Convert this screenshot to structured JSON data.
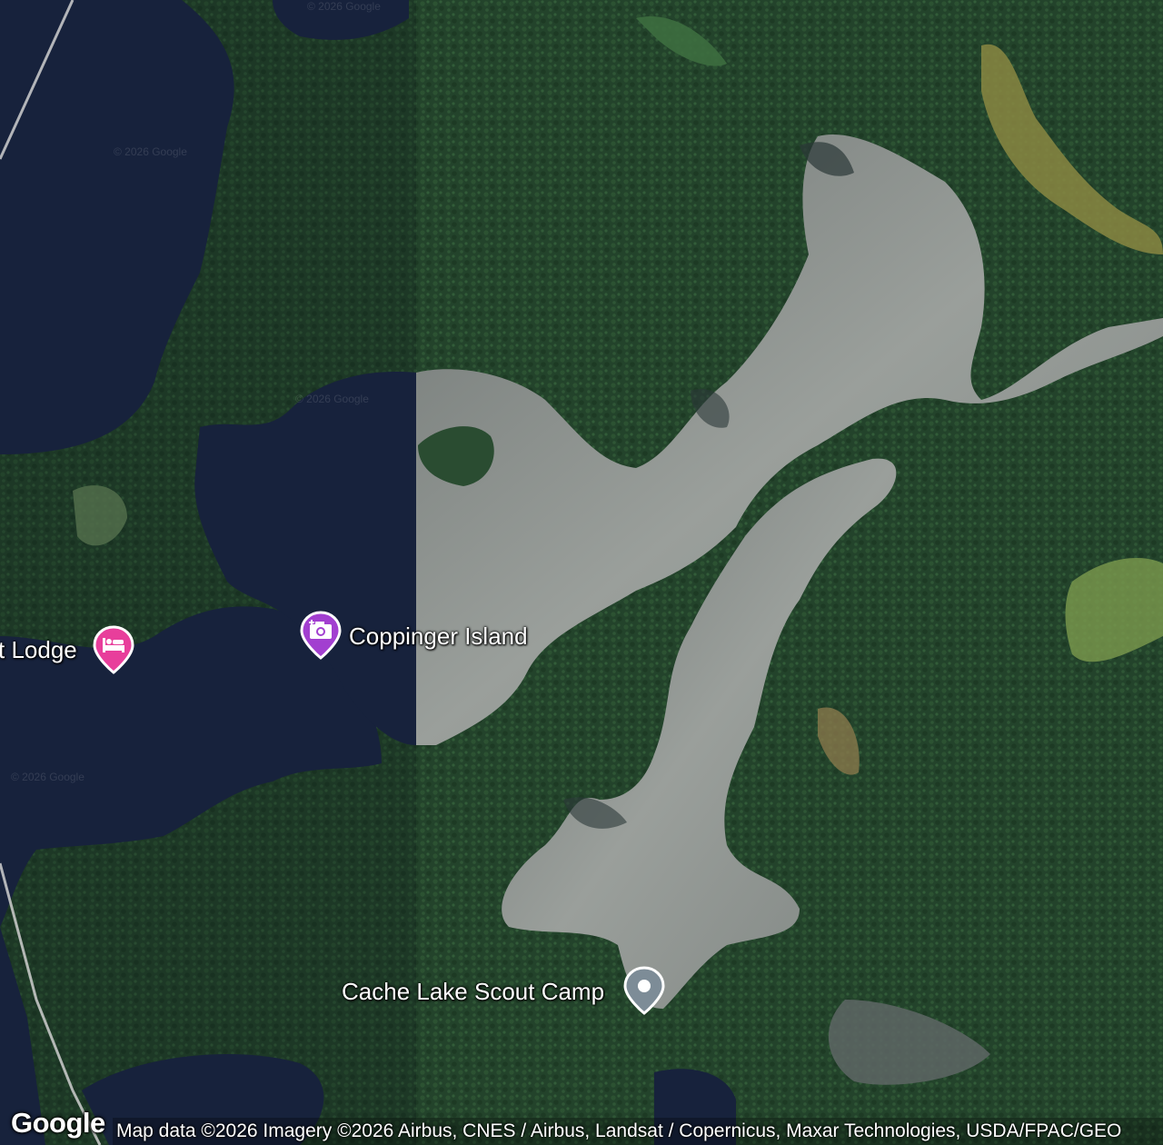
{
  "map": {
    "view": "satellite",
    "places": [
      {
        "id": "lodge",
        "label": "t Lodge",
        "icon": "bed-icon",
        "color": "#e83e9b"
      },
      {
        "id": "island",
        "label": "Coppinger Island",
        "icon": "camera-icon",
        "color": "#a23fd0"
      },
      {
        "id": "camp",
        "label": "Cache Lake Scout Camp",
        "icon": "location-dot-icon",
        "color": "#7d8c97"
      }
    ],
    "watermark": "© 2026 Google",
    "attribution": "Map data ©2026 Imagery ©2026 Airbus, CNES / Airbus, Landsat / Copernicus, Maxar Technologies, USDA/FPAC/GEO",
    "logo": "Google",
    "colors": {
      "forest": "#22402a",
      "dark_water": "#17223c",
      "bright_water": "#8f9592"
    }
  }
}
